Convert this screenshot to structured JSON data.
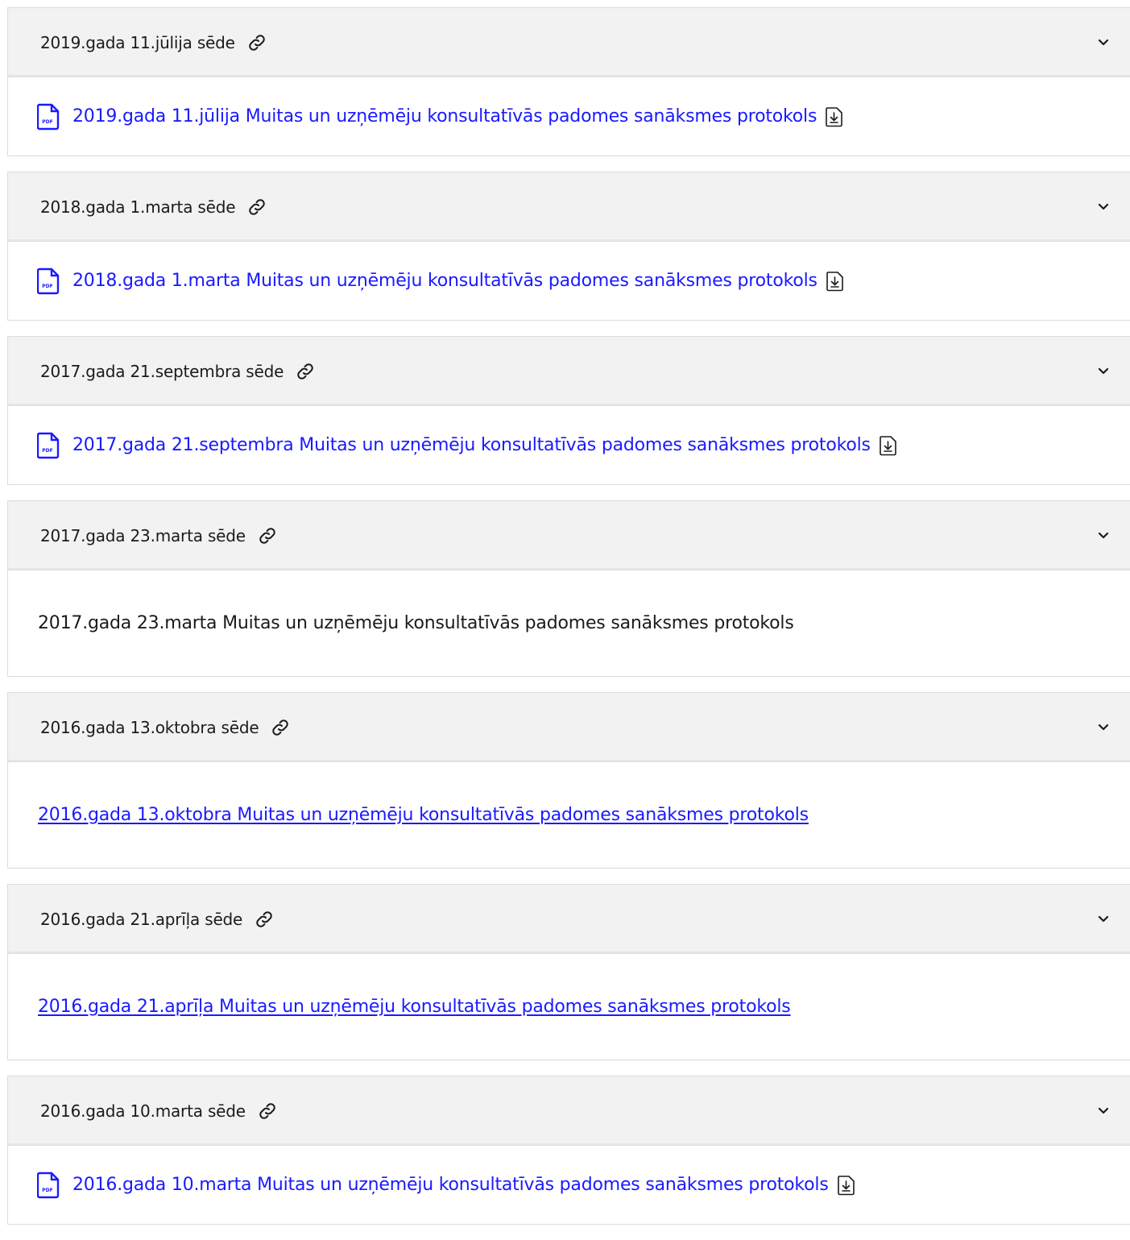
{
  "meetings": [
    {
      "title": "2019.gada 11.jūlija sēde",
      "document": "2019.gada 11.jūlija Muitas un uzņēmēju konsultatīvās padomes sanāksmes protokols",
      "kind": "pdf"
    },
    {
      "title": "2018.gada 1.marta sēde",
      "document": "2018.gada 1.marta Muitas un uzņēmēju konsultatīvās padomes sanāksmes protokols",
      "kind": "pdf"
    },
    {
      "title": "2017.gada 21.septembra sēde",
      "document": "2017.gada 21.septembra Muitas un uzņēmēju konsultatīvās padomes sanāksmes protokols",
      "kind": "pdf"
    },
    {
      "title": "2017.gada 23.marta sēde",
      "document": "2017.gada 23.marta Muitas un uzņēmēju konsultatīvās padomes sanāksmes protokols",
      "kind": "text"
    },
    {
      "title": "2016.gada 13.oktobra sēde",
      "document": "2016.gada 13.oktobra Muitas un uzņēmēju konsultatīvās padomes sanāksmes protokols",
      "kind": "link"
    },
    {
      "title": "2016.gada 21.aprīļa sēde",
      "document": "2016.gada 21.aprīļa Muitas un uzņēmēju konsultatīvās padomes sanāksmes protokols",
      "kind": "link"
    },
    {
      "title": "2016.gada 10.marta sēde",
      "document": "2016.gada 10.marta Muitas un uzņēmēju konsultatīvās padomes sanāksmes protokols",
      "kind": "pdf"
    }
  ],
  "icons": {
    "anchor": "link-icon",
    "toggle": "chevron-down-icon",
    "pdf": "pdf-file-icon",
    "download": "download-icon"
  },
  "colors": {
    "link": "#1a1aff",
    "header_bg": "#f2f2f2",
    "border": "#dcdcdc"
  }
}
